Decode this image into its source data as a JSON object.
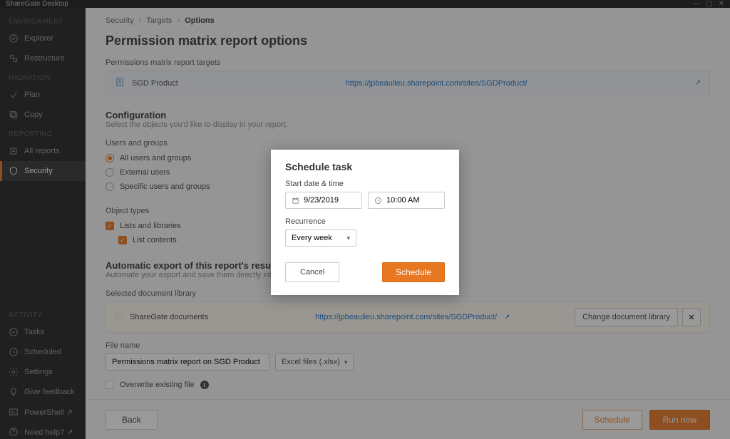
{
  "titlebar": {
    "title": "ShareGate Desktop"
  },
  "sidebar": {
    "groups": [
      {
        "title": "ENVIRONMENT",
        "items": [
          {
            "label": "Explorer",
            "icon": "compass"
          },
          {
            "label": "Restructure",
            "icon": "restructure"
          }
        ]
      },
      {
        "title": "MIGRATION",
        "items": [
          {
            "label": "Plan",
            "icon": "plan"
          },
          {
            "label": "Copy",
            "icon": "copy"
          }
        ]
      },
      {
        "title": "REPORTING",
        "items": [
          {
            "label": "All reports",
            "icon": "reports"
          },
          {
            "label": "Security",
            "icon": "shield",
            "active": true
          }
        ]
      }
    ],
    "activity_title": "ACTIVITY",
    "footer_items": [
      {
        "label": "Tasks",
        "icon": "tasks"
      },
      {
        "label": "Scheduled",
        "icon": "clock"
      },
      {
        "label": "Settings",
        "icon": "gear"
      },
      {
        "label": "Give feedback",
        "icon": "bulb"
      },
      {
        "label": "PowerShell ↗",
        "icon": "powershell"
      },
      {
        "label": "Need help? ↗",
        "icon": "help"
      }
    ]
  },
  "breadcrumbs": {
    "a": "Security",
    "b": "Targets",
    "c": "Options"
  },
  "page": {
    "title": "Permission matrix report options",
    "targets_label": "Permissions matrix report targets",
    "target_name": "SGD Product",
    "target_url": "https://jpbeaulieu.sharepoint.com/sites/SGDProduct/",
    "config_title": "Configuration",
    "config_sub": "Select the objects you'd like to display in your report.",
    "ug_label": "Users and groups",
    "ug_opts": [
      "All users and groups",
      "External users",
      "Specific users and groups"
    ],
    "ot_label": "Object types",
    "ot_opts": [
      "Lists and libraries",
      "List contents"
    ],
    "export_title": "Automatic export of this report's results",
    "export_sub": "Automate your export and save them directly into the document library",
    "sel_lib_label": "Selected document library",
    "lib_name": "ShareGate documents",
    "lib_url": "https://jpbeaulieu.sharepoint.com/sites/SGDProduct/",
    "change_lib_btn": "Change document library",
    "file_label": "File name",
    "file_value": "Permissions matrix report on SGD Product",
    "file_format": "Excel files (.xlsx)",
    "overwrite_label": "Overwrite existing file"
  },
  "footer": {
    "back": "Back",
    "schedule": "Schedule",
    "run": "Run now"
  },
  "modal": {
    "title": "Schedule task",
    "dt_label": "Start date & time",
    "date": "9/23/2019",
    "time": "10:00 AM",
    "rec_label": "Recurrence",
    "rec_value": "Every week",
    "cancel": "Cancel",
    "schedule": "Schedule"
  }
}
